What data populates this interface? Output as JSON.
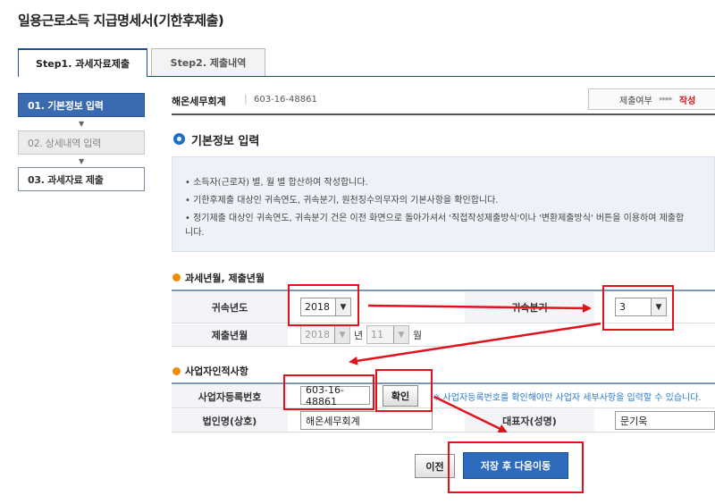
{
  "page": {
    "title": "일용근로소득 지급명세서(기한후제출)"
  },
  "tabs": [
    {
      "label": "Step1. 과세자료제출",
      "active": true
    },
    {
      "label": "Step2. 제출내역",
      "active": false
    }
  ],
  "sidebar": {
    "steps": [
      {
        "label": "01. 기본정보 입력",
        "state": "active"
      },
      {
        "label": "02. 상세내역 입력",
        "state": "done"
      },
      {
        "label": "03. 과세자료 제출",
        "state": "todo"
      }
    ],
    "arrow": "▼"
  },
  "firm": {
    "name": "해온세무회계",
    "separator": "|",
    "biz_no": "603-16-48861"
  },
  "status": {
    "label": "제출여부",
    "arrows": "▸▸▸▸",
    "value": "작성"
  },
  "section": {
    "title": "기본정보 입력",
    "info": [
      "• 소득자(근로자) 별, 월 별 합산하여 작성합니다.",
      "• 기한후제출 대상인 귀속연도, 귀속분기, 원천징수의무자의 기본사항을 확인합니다.",
      "• 정기제출 대상인 귀속연도, 귀속분기 건은 이전 화면으로 돌아가셔서 '직접작성제출방식'이나 '변환제출방식' 버튼을 이용하여 제출합",
      "  니다."
    ]
  },
  "period": {
    "title": "과세년월, 제출년월",
    "year_label": "귀속년도",
    "year_value": "2018",
    "quarter_label": "귀속분기",
    "quarter_value": "3",
    "submit_label": "제출년월",
    "submit_year": "2018",
    "year_unit": "년",
    "submit_month": "11",
    "month_unit": "월"
  },
  "business": {
    "title": "사업자인적사항",
    "bizno_label": "사업자등록번호",
    "bizno_value": "603-16-48861",
    "confirm_label": "확인",
    "notice": "※ 사업자등록번호를 확인해야만 사업자 세부사항을 입력할 수 있습니다.",
    "corp_label": "법인명(상호)",
    "corp_value": "해온세무회계",
    "rep_label": "대표자(성명)",
    "rep_value": "문기욱"
  },
  "actions": {
    "prev_label": "이전",
    "save_label": "저장 후 다음이동"
  },
  "icons": {
    "select_arrow": "▼"
  },
  "colors": {
    "accent": "#3a6bb1",
    "highlight": "#e0121c",
    "notice": "#2d7bc7",
    "status": "#d8131b"
  }
}
